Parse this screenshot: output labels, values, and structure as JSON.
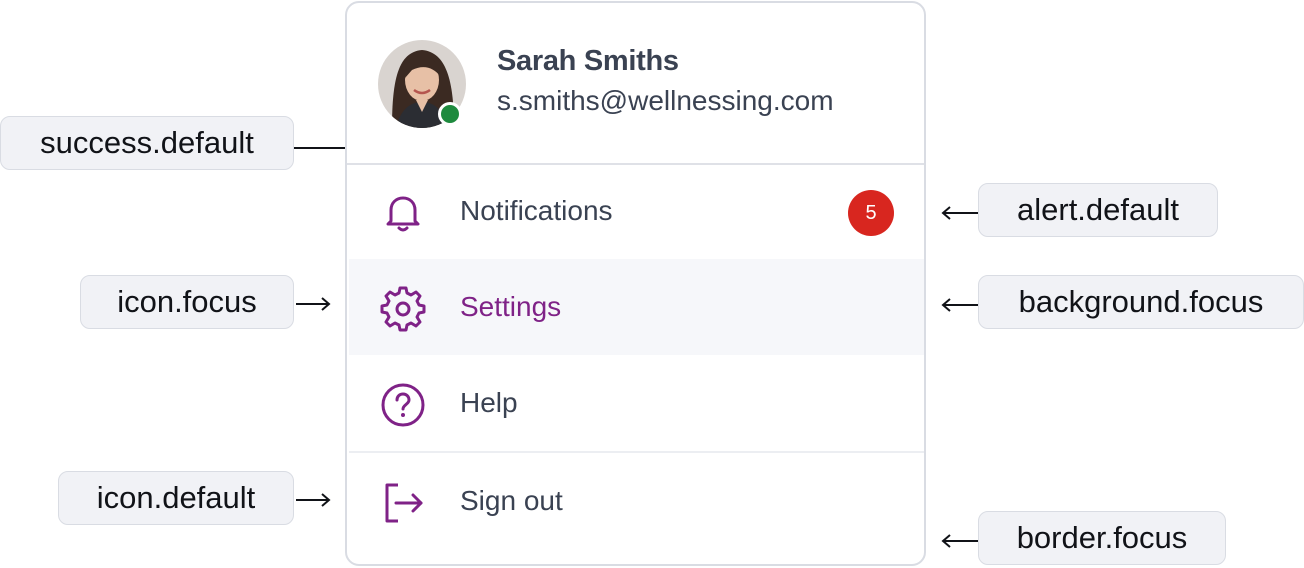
{
  "profile": {
    "name": "Sarah Smiths",
    "email": "s.smiths@wellnessing.com",
    "status": "online"
  },
  "menu": {
    "items": [
      {
        "label": "Notifications",
        "icon": "bell-icon",
        "badge": "5"
      },
      {
        "label": "Settings",
        "icon": "gear-icon",
        "state": "focus"
      },
      {
        "label": "Help",
        "icon": "help-circle-icon"
      },
      {
        "label": "Sign out",
        "icon": "sign-out-icon"
      }
    ]
  },
  "annotations": {
    "success": "success.default",
    "alert": "alert.default",
    "icon_focus": "icon.focus",
    "background_focus": "background.focus",
    "icon_default": "icon.default",
    "border_focus": "border.focus"
  },
  "colors": {
    "accent": "#7f2287",
    "text": "#3a4252",
    "success": "#1e8a3e",
    "alert": "#d8261f",
    "focus_background": "#f6f7fa",
    "border": "#d9dce3"
  }
}
